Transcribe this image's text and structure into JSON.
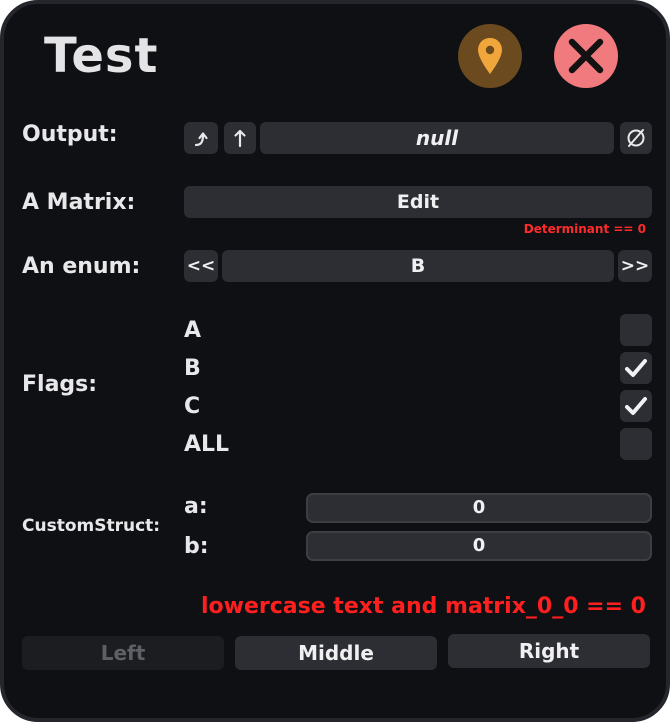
{
  "window": {
    "title": "Test"
  },
  "header": {
    "pin_icon": "location-pin-icon",
    "close_icon": "close-x-icon"
  },
  "output": {
    "label": "Output:",
    "jump_icon": "jump-to-icon",
    "up_icon": "arrow-up-icon",
    "value": "null",
    "clear_icon": "empty-set-icon"
  },
  "matrix": {
    "label": "A Matrix:",
    "edit_label": "Edit",
    "error": "Determinant == 0"
  },
  "enum": {
    "label": "An enum:",
    "prev_label": "<<",
    "value": "B",
    "next_label": ">>"
  },
  "flags": {
    "label": "Flags:",
    "items": [
      {
        "label": "A",
        "checked": false
      },
      {
        "label": "B",
        "checked": true
      },
      {
        "label": "C",
        "checked": true
      },
      {
        "label": "ALL",
        "checked": false
      }
    ]
  },
  "custom_struct": {
    "label": "CustomStruct:",
    "a_label": "a:",
    "a_value": "0",
    "b_label": "b:",
    "b_value": "0"
  },
  "validation": {
    "message": "lowercase text and matrix_0_0 == 0"
  },
  "buttons": {
    "left": "Left",
    "middle": "Middle",
    "right": "Right"
  },
  "colors": {
    "background": "#0f1014",
    "control": "#2c2e33",
    "error": "#ff1f1f",
    "pin_button": "#6a4a1e",
    "close_button": "#f07a7e"
  }
}
